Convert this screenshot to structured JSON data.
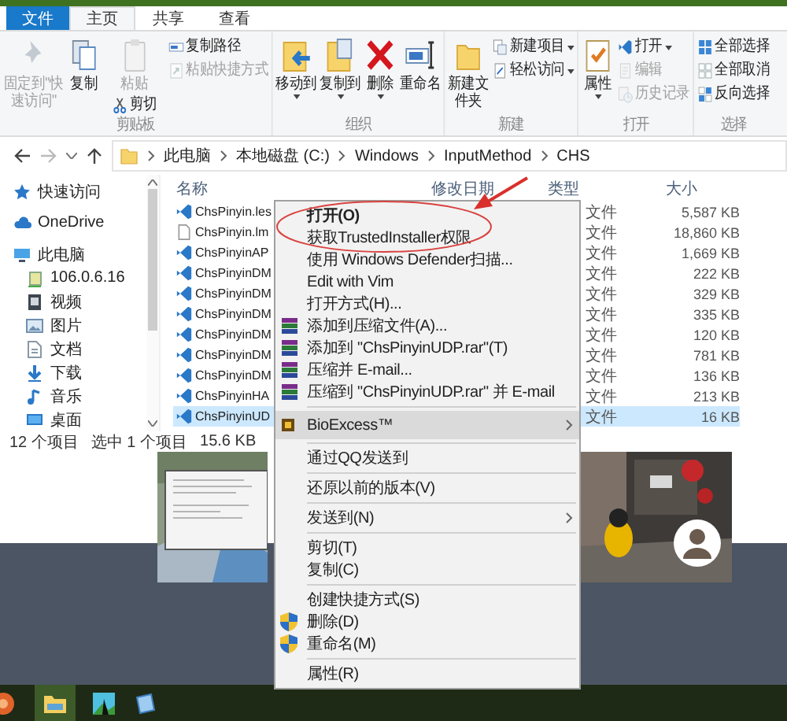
{
  "ribbon_tabs": [
    {
      "label": "文件",
      "kind": "file",
      "selected": false
    },
    {
      "label": "主页",
      "kind": "tab",
      "selected": true
    },
    {
      "label": "共享",
      "kind": "tab",
      "selected": false
    },
    {
      "label": "查看",
      "kind": "tab",
      "selected": false
    }
  ],
  "ribbon": {
    "groups": [
      {
        "label": "剪贴板",
        "items": [
          {
            "label": "固定到\"快速访问\"",
            "disabled": true,
            "dropdown": false
          },
          {
            "label": "复制",
            "disabled": false,
            "dropdown": false
          },
          {
            "label": "粘贴",
            "disabled": true,
            "dropdown": false
          },
          {
            "label": "剪切",
            "disabled": false,
            "dropdown": false
          },
          {
            "label": "复制路径",
            "disabled": false,
            "dropdown": false
          },
          {
            "label": "粘贴快捷方式",
            "disabled": true,
            "dropdown": false
          }
        ]
      },
      {
        "label": "组织",
        "items": [
          {
            "label": "移动到",
            "disabled": false,
            "dropdown": true
          },
          {
            "label": "复制到",
            "disabled": false,
            "dropdown": true
          },
          {
            "label": "删除",
            "disabled": false,
            "dropdown": true
          },
          {
            "label": "重命名",
            "disabled": false,
            "dropdown": false
          }
        ]
      },
      {
        "label": "新建",
        "items": [
          {
            "label": "新建文件夹",
            "disabled": false,
            "dropdown": false
          },
          {
            "label": "新建项目",
            "disabled": false,
            "dropdown": true
          },
          {
            "label": "轻松访问",
            "disabled": false,
            "dropdown": true
          }
        ]
      },
      {
        "label": "打开",
        "items": [
          {
            "label": "属性",
            "disabled": false,
            "dropdown": true
          },
          {
            "label": "打开",
            "disabled": false,
            "dropdown": true
          },
          {
            "label": "编辑",
            "disabled": true,
            "dropdown": false
          },
          {
            "label": "历史记录",
            "disabled": true,
            "dropdown": false
          }
        ]
      },
      {
        "label": "选择",
        "items": [
          {
            "label": "全部选择",
            "disabled": false,
            "dropdown": false
          },
          {
            "label": "全部取消",
            "disabled": false,
            "dropdown": false
          },
          {
            "label": "反向选择",
            "disabled": false,
            "dropdown": false
          }
        ]
      }
    ]
  },
  "address": {
    "segments": [
      "此电脑",
      "本地磁盘 (C:)",
      "Windows",
      "InputMethod",
      "CHS"
    ]
  },
  "nav": {
    "items": [
      {
        "label": "快速访问"
      },
      {
        "label": "OneDrive"
      },
      {
        "label": "此电脑",
        "children": [
          {
            "label": "106.0.6.16"
          },
          {
            "label": "视频"
          },
          {
            "label": "图片"
          },
          {
            "label": "文档"
          },
          {
            "label": "下载"
          },
          {
            "label": "音乐"
          },
          {
            "label": "桌面"
          }
        ]
      }
    ]
  },
  "file_list": {
    "columns": [
      "名称",
      "修改日期",
      "类型",
      "大小"
    ],
    "rows": [
      {
        "name": "ChsPinyin.les",
        "kind": "program",
        "type": "文件",
        "size": "5,587 KB",
        "selected": false
      },
      {
        "name": "ChsPinyin.lm",
        "kind": "document",
        "type": "文件",
        "size": "18,860 KB",
        "selected": false
      },
      {
        "name": "ChsPinyinAP",
        "kind": "program",
        "type": "文件",
        "size": "1,669 KB",
        "selected": false
      },
      {
        "name": "ChsPinyinDM",
        "kind": "program",
        "type": "文件",
        "size": "222 KB",
        "selected": false
      },
      {
        "name": "ChsPinyinDM",
        "kind": "program",
        "type": "文件",
        "size": "329 KB",
        "selected": false
      },
      {
        "name": "ChsPinyinDM",
        "kind": "program",
        "type": "文件",
        "size": "335 KB",
        "selected": false
      },
      {
        "name": "ChsPinyinDM",
        "kind": "program",
        "type": "文件",
        "size": "120 KB",
        "selected": false
      },
      {
        "name": "ChsPinyinDM",
        "kind": "program",
        "type": "文件",
        "size": "781 KB",
        "selected": false
      },
      {
        "name": "ChsPinyinDM",
        "kind": "program",
        "type": "文件",
        "size": "136 KB",
        "selected": false
      },
      {
        "name": "ChsPinyinHA",
        "kind": "program",
        "type": "文件",
        "size": "213 KB",
        "selected": false
      },
      {
        "name": "ChsPinyinUD",
        "kind": "program",
        "type": "文件",
        "size": "16 KB",
        "selected": true
      }
    ]
  },
  "status_bar": [
    "12 个项目",
    "选中 1 个项目",
    "15.6 KB"
  ],
  "context_menu": {
    "items": [
      {
        "kind": "plain",
        "label": "打开(O)",
        "bold": true,
        "selected": false,
        "submenu": false
      },
      {
        "kind": "plain",
        "label": "获取TrustedInstaller权限",
        "bold": false,
        "selected": false,
        "submenu": false
      },
      {
        "kind": "plain",
        "label": "使用 Windows Defender扫描...",
        "bold": false,
        "selected": false,
        "submenu": false
      },
      {
        "kind": "plain",
        "label": "Edit with Vim",
        "bold": false,
        "selected": false,
        "submenu": false
      },
      {
        "kind": "plain",
        "label": "打开方式(H)...",
        "bold": false,
        "selected": false,
        "submenu": false
      },
      {
        "kind": "archive",
        "label": "添加到压缩文件(A)...",
        "bold": false,
        "selected": false,
        "submenu": false
      },
      {
        "kind": "archive",
        "label": "添加到 \"ChsPinyinUDP.rar\"(T)",
        "bold": false,
        "selected": false,
        "submenu": false
      },
      {
        "kind": "archive",
        "label": "压缩并 E-mail...",
        "bold": false,
        "selected": false,
        "submenu": false
      },
      {
        "kind": "archive",
        "label": "压缩到 \"ChsPinyinUDP.rar\" 并 E-mail",
        "bold": false,
        "selected": false,
        "submenu": false
      },
      {
        "kind": "separator"
      },
      {
        "kind": "app",
        "label": "BioExcess™",
        "bold": false,
        "selected": true,
        "submenu": true
      },
      {
        "kind": "separator"
      },
      {
        "kind": "plain",
        "label": "通过QQ发送到",
        "bold": false,
        "selected": false,
        "submenu": false
      },
      {
        "kind": "separator"
      },
      {
        "kind": "plain",
        "label": "还原以前的版本(V)",
        "bold": false,
        "selected": false,
        "submenu": false
      },
      {
        "kind": "separator"
      },
      {
        "kind": "plain",
        "label": "发送到(N)",
        "bold": false,
        "selected": false,
        "submenu": true
      },
      {
        "kind": "separator"
      },
      {
        "kind": "plain",
        "label": "剪切(T)",
        "bold": false,
        "selected": false,
        "submenu": false
      },
      {
        "kind": "plain",
        "label": "复制(C)",
        "bold": false,
        "selected": false,
        "submenu": false
      },
      {
        "kind": "separator"
      },
      {
        "kind": "plain",
        "label": "创建快捷方式(S)",
        "bold": false,
        "selected": false,
        "submenu": false
      },
      {
        "kind": "shield",
        "label": "删除(D)",
        "bold": false,
        "selected": false,
        "submenu": false
      },
      {
        "kind": "shield",
        "label": "重命名(M)",
        "bold": false,
        "selected": false,
        "submenu": false
      },
      {
        "kind": "separator"
      },
      {
        "kind": "plain",
        "label": "属性(R)",
        "bold": false,
        "selected": false,
        "submenu": false
      }
    ]
  }
}
